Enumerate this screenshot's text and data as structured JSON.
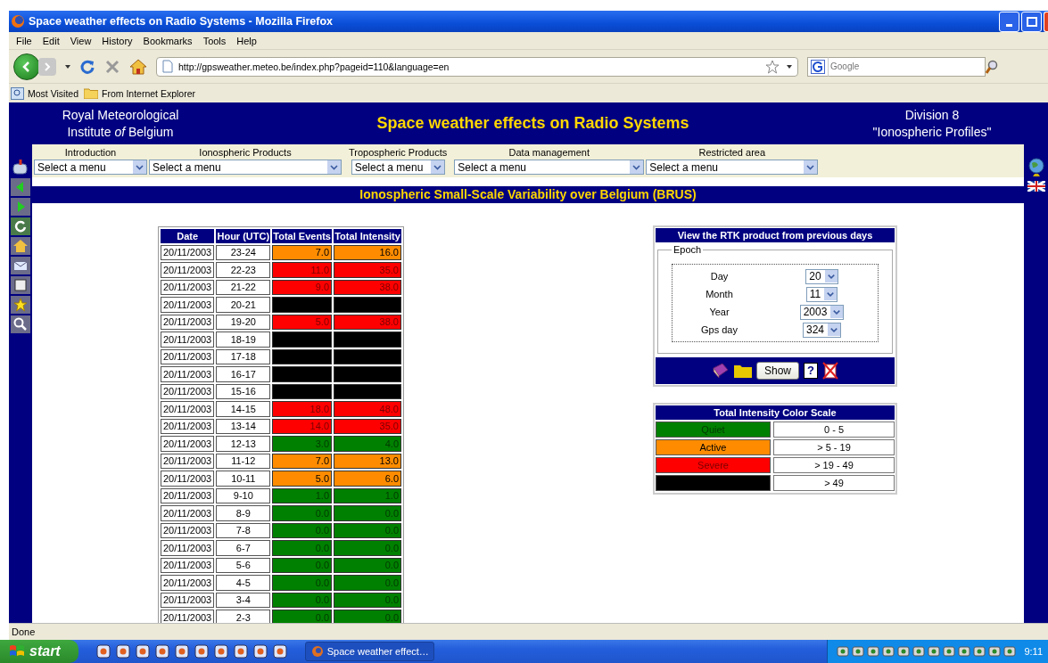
{
  "window": {
    "title": "Space weather effects on Radio Systems - Mozilla Firefox"
  },
  "menu_bar": [
    "File",
    "Edit",
    "View",
    "History",
    "Bookmarks",
    "Tools",
    "Help"
  ],
  "address_bar": {
    "value": "http://gpsweather.meteo.be/index.php?pageid=110&language=en"
  },
  "search_box": {
    "placeholder": "Google"
  },
  "bookmarks": [
    "Most Visited",
    "From Internet Explorer"
  ],
  "header": {
    "org_line1": "Royal Meteorological",
    "org_line2": "Institute *of* Belgium",
    "title": "Space weather effects on Radio Systems",
    "division": "Division 8",
    "division_name": "\"Ionospheric Profiles\""
  },
  "nav_menus": [
    {
      "label": "Introduction",
      "value": "Select a menu"
    },
    {
      "label": "Ionospheric Products",
      "value": "Select a menu"
    },
    {
      "label": "Tropospheric Products",
      "value": "Select a menu"
    },
    {
      "label": "Data management",
      "value": "Select a menu"
    },
    {
      "label": "Restricted area",
      "value": "Select a menu"
    }
  ],
  "section_title": "Ionospheric Small-Scale Variability over Belgium (BRUS)",
  "table": {
    "columns": [
      "Date",
      "Hour (UTC)",
      "Total Events",
      "Total Intensity"
    ],
    "rows": [
      {
        "date": "20/11/2003",
        "hour": "23-24",
        "events": "7.0",
        "intensity": "16.0",
        "color": "#ff8c00"
      },
      {
        "date": "20/11/2003",
        "hour": "22-23",
        "events": "11.0",
        "intensity": "35.0",
        "color": "#ff0000"
      },
      {
        "date": "20/11/2003",
        "hour": "21-22",
        "events": "9.0",
        "intensity": "38.0",
        "color": "#ff0000"
      },
      {
        "date": "20/11/2003",
        "hour": "20-21",
        "color": "#000000"
      },
      {
        "date": "20/11/2003",
        "hour": "19-20",
        "events": "5.0",
        "intensity": "38.0",
        "color": "#ff0000"
      },
      {
        "date": "20/11/2003",
        "hour": "18-19",
        "color": "#000000"
      },
      {
        "date": "20/11/2003",
        "hour": "17-18",
        "color": "#000000"
      },
      {
        "date": "20/11/2003",
        "hour": "16-17",
        "color": "#000000"
      },
      {
        "date": "20/11/2003",
        "hour": "15-16",
        "color": "#000000"
      },
      {
        "date": "20/11/2003",
        "hour": "14-15",
        "events": "18.0",
        "intensity": "48.0",
        "color": "#ff0000"
      },
      {
        "date": "20/11/2003",
        "hour": "13-14",
        "events": "14.0",
        "intensity": "35.0",
        "color": "#ff0000"
      },
      {
        "date": "20/11/2003",
        "hour": "12-13",
        "events": "3.0",
        "intensity": "4.0",
        "color": "#008000"
      },
      {
        "date": "20/11/2003",
        "hour": "11-12",
        "events": "7.0",
        "intensity": "13.0",
        "color": "#ff8c00"
      },
      {
        "date": "20/11/2003",
        "hour": "10-11",
        "events": "5.0",
        "intensity": "6.0",
        "color": "#ff8c00"
      },
      {
        "date": "20/11/2003",
        "hour": "9-10",
        "events": "1.0",
        "intensity": "1.0",
        "color": "#008000"
      },
      {
        "date": "20/11/2003",
        "hour": "8-9",
        "events": "0.0",
        "intensity": "0.0",
        "color": "#008000"
      },
      {
        "date": "20/11/2003",
        "hour": "7-8",
        "events": "0.0",
        "intensity": "0.0",
        "color": "#008000"
      },
      {
        "date": "20/11/2003",
        "hour": "6-7",
        "events": "0.0",
        "intensity": "0.0",
        "color": "#008000"
      },
      {
        "date": "20/11/2003",
        "hour": "5-6",
        "events": "0.0",
        "intensity": "0.0",
        "color": "#008000"
      },
      {
        "date": "20/11/2003",
        "hour": "4-5",
        "events": "0.0",
        "intensity": "0.0",
        "color": "#008000"
      },
      {
        "date": "20/11/2003",
        "hour": "3-4",
        "events": "0.0",
        "intensity": "0.0",
        "color": "#008000"
      },
      {
        "date": "20/11/2003",
        "hour": "2-3",
        "events": "0.0",
        "intensity": "0.0",
        "color": "#008000"
      }
    ]
  },
  "rtk_panel": {
    "title": "View the RTK product from previous days",
    "legend": "Epoch",
    "fields": [
      {
        "label": "Day",
        "value": "20"
      },
      {
        "label": "Month",
        "value": "11"
      },
      {
        "label": "Year",
        "value": "2003"
      },
      {
        "label": "Gps day",
        "value": "324"
      }
    ],
    "button": "Show",
    "help": "?"
  },
  "color_scale": {
    "title": "Total Intensity Color Scale",
    "items": [
      {
        "label": "Quiet",
        "range": "0 - 5",
        "color": "#008000"
      },
      {
        "label": "Active",
        "range": "> 5 - 19",
        "color": "#ff8c00"
      },
      {
        "label": "Severe",
        "range": "> 19 - 49",
        "color": "#ff0000"
      },
      {
        "range": "> 49",
        "color": "#000000"
      }
    ]
  },
  "status_bar": "Done",
  "taskbar": {
    "start": "start",
    "task": "Space weather effect…",
    "clock": "9:11"
  }
}
